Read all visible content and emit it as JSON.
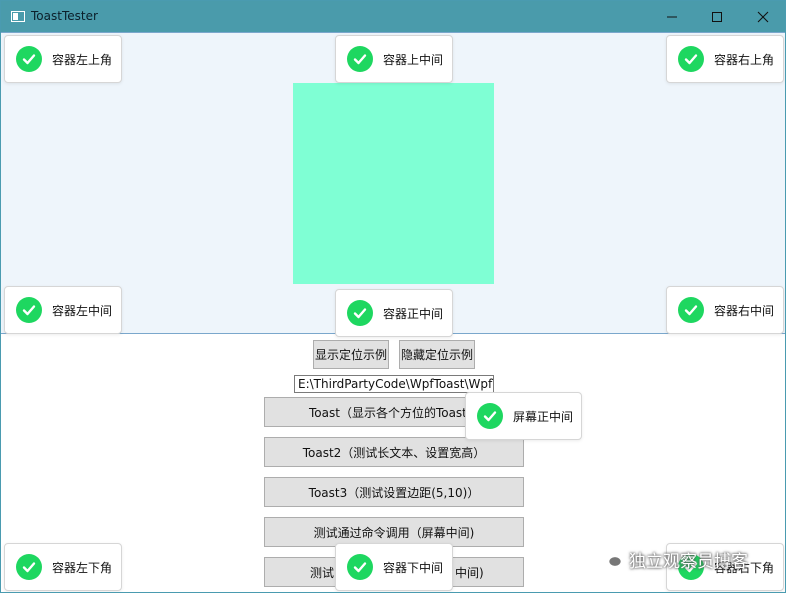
{
  "window": {
    "title": "ToastTester"
  },
  "colors": {
    "titlebar": "#4a9bab",
    "top_area_bg": "#eef5fb",
    "square": "#7fffd4",
    "check": "#1ed760"
  },
  "toasts": {
    "container_top_left": "容器左上角",
    "container_top_center": "容器上中间",
    "container_top_right": "容器右上角",
    "container_middle_left": "容器左中间",
    "container_center": "容器正中间",
    "container_middle_right": "容器右中间",
    "screen_center": "屏幕正中间",
    "container_bottom_left": "容器左下角",
    "container_bottom_center": "容器下中间",
    "container_bottom_right": "容器右下角"
  },
  "buttons": {
    "show_positioning": "显示定位示例",
    "hide_positioning": "隐藏定位示例",
    "toast1": "Toast（显示各个方位的Toast）",
    "toast2": "Toast2（测试长文本、设置宽高）",
    "toast3": "Toast3（测试设置边距(5,10)）",
    "command": "测试通过命令调用（屏幕中间)",
    "toast5_visible": "测试",
    "toast5_tail": "中间)"
  },
  "path_field": {
    "value": "E:\\ThirdPartyCode\\WpfToast\\WpfToast\\bin"
  },
  "watermark": {
    "text": "独立观察员博客"
  }
}
